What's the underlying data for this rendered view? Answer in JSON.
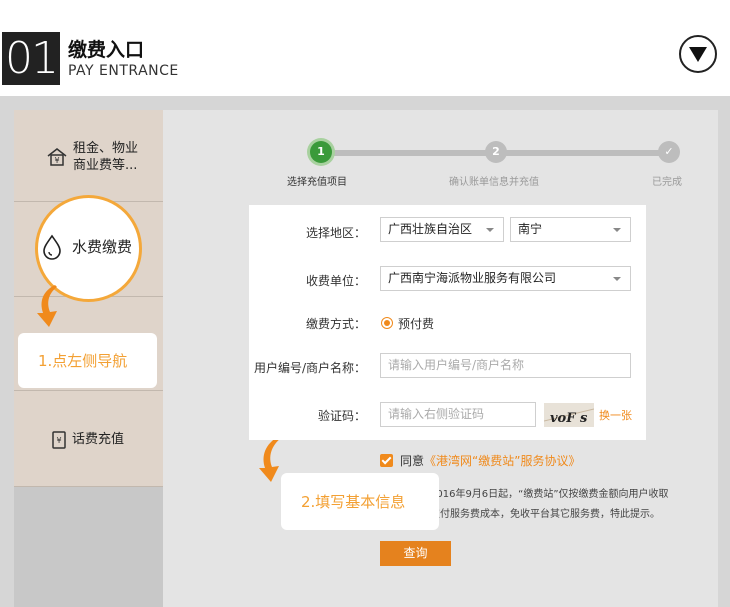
{
  "header": {
    "section_number": "01",
    "title": "缴费入口",
    "subtitle": "PAY ENTRANCE"
  },
  "sidebar": {
    "items": [
      {
        "label_line1": "租金、物业",
        "label_line2": "商业费等...",
        "icon": "house-yen-icon"
      },
      {
        "label": "水费缴费",
        "icon": "water-drop-icon"
      },
      {
        "label": ""
      },
      {
        "label": "话费充值",
        "icon": "phone-yen-icon"
      }
    ]
  },
  "tips": {
    "nav_tip": "1.点左侧导航",
    "fill_tip": "2.填写基本信息"
  },
  "steps": [
    {
      "number": "1",
      "label": "选择充值项目",
      "state": "active"
    },
    {
      "number": "2",
      "label": "确认账单信息并充值",
      "state": "pending"
    },
    {
      "number": "✓",
      "label": "已完成",
      "state": "pending"
    }
  ],
  "form": {
    "region_label": "选择地区：",
    "province": "广西壮族自治区",
    "city": "南宁",
    "payee_label": "收费单位：",
    "payee": "广西南宁海派物业服务有限公司",
    "method_label": "缴费方式：",
    "method": "预付费",
    "account_label": "用户编号/商户名称：",
    "account_placeholder": "请输入用户编号/商户名称",
    "captcha_label": "验证码：",
    "captcha_placeholder": "请输入右侧验证码",
    "captcha_text": "voF s",
    "refresh_label": "换一张"
  },
  "agreement": {
    "prefix": "同意",
    "link": "《港湾网“缴费站”服务协议》",
    "notice_line1": "2016年9月6日起，“缴费站”仅按缴费金额向用户收取",
    "notice_line2": "支付服务费成本，免收平台其它服务费，特此提示。"
  },
  "query_button": "查询",
  "colors": {
    "accent": "#f08a1c",
    "step_active": "#3a9a3a",
    "tip_text": "#f3a033"
  }
}
